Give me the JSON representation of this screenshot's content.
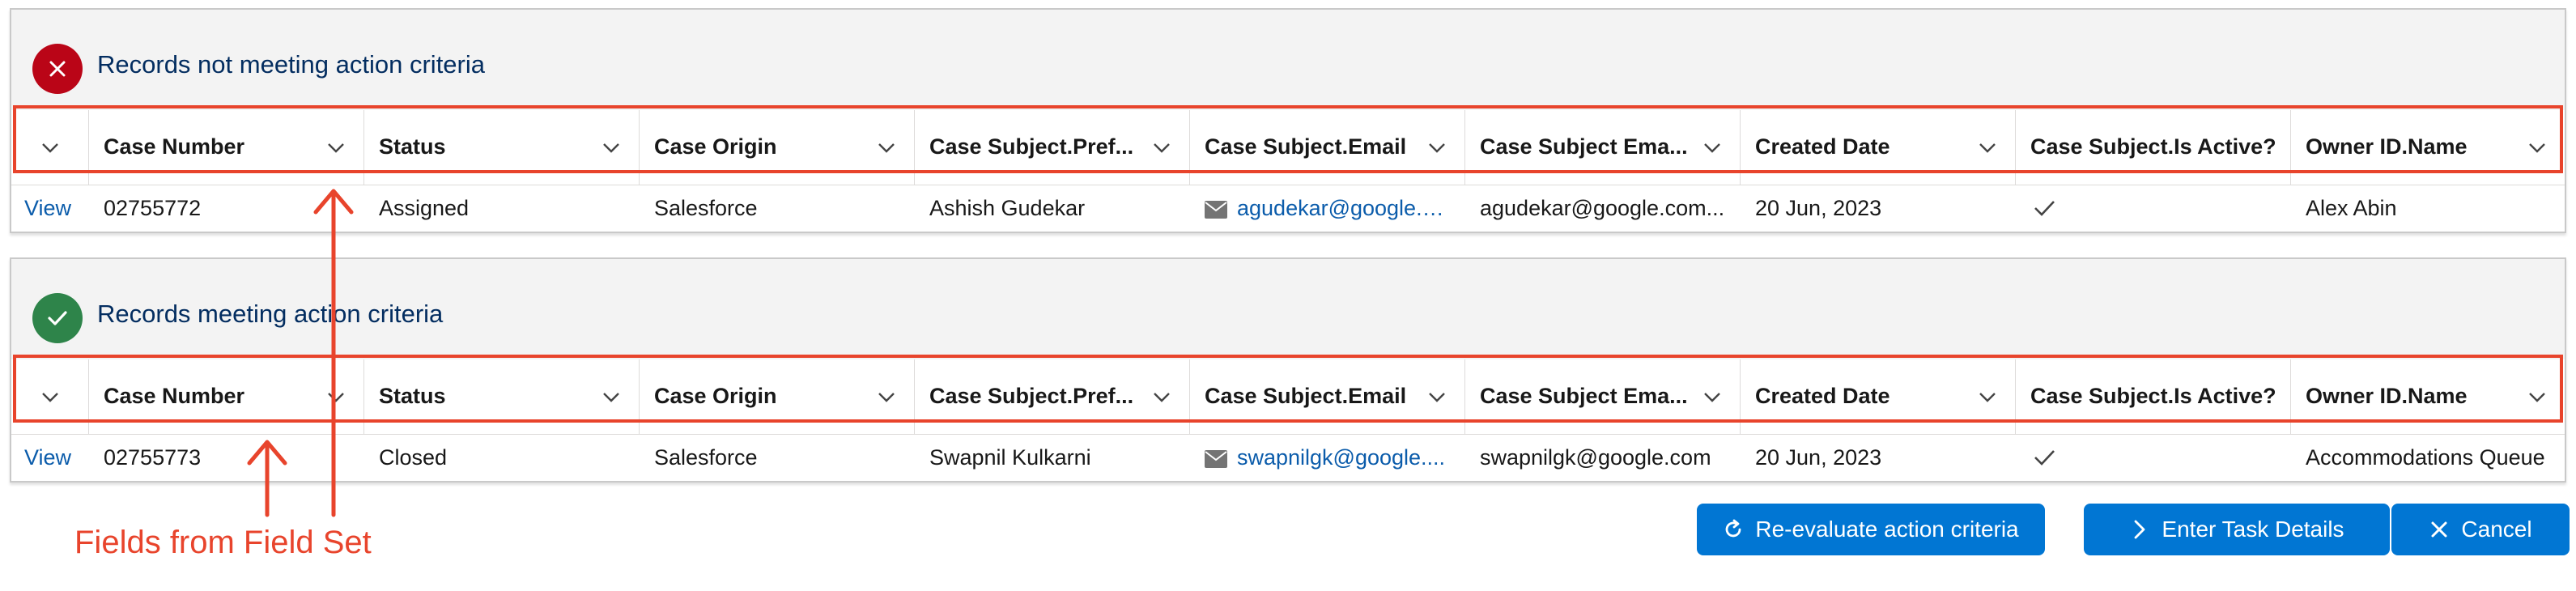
{
  "colors": {
    "highlight": "#e8442c",
    "brand_button": "#0176d3",
    "link": "#0b5cab",
    "error": "#ba0517",
    "success": "#2e844a",
    "title": "#032d60"
  },
  "columns": [
    "Case Number",
    "Status",
    "Case Origin",
    "Case Subject.Pref...",
    "Case Subject.Email",
    "Case Subject Ema...",
    "Created Date",
    "Case Subject.Is Active?",
    "Owner ID.Name"
  ],
  "sections": [
    {
      "title": "Records not meeting action criteria",
      "status_icon": "close-icon",
      "row": {
        "action": "View",
        "case_number": "02755772",
        "status": "Assigned",
        "origin": "Salesforce",
        "pref": "Ashish Gudekar",
        "email": "agudekar@google.c...",
        "subject_email": "agudekar@google.com...",
        "created_date": "20 Jun, 2023",
        "owner": "Alex Abin"
      }
    },
    {
      "title": "Records meeting action criteria",
      "status_icon": "check-icon",
      "row": {
        "action": "View",
        "case_number": "02755773",
        "status": "Closed",
        "origin": "Salesforce",
        "pref": "Swapnil Kulkarni",
        "email": "swapnilgk@google....",
        "subject_email": "swapnilgk@google.com",
        "created_date": "20 Jun, 2023",
        "owner": "Accommodations Queue"
      }
    }
  ],
  "annotation": "Fields from Field Set",
  "buttons": {
    "reevaluate": "Re-evaluate action criteria",
    "task": "Enter Task Details",
    "cancel": "Cancel"
  }
}
